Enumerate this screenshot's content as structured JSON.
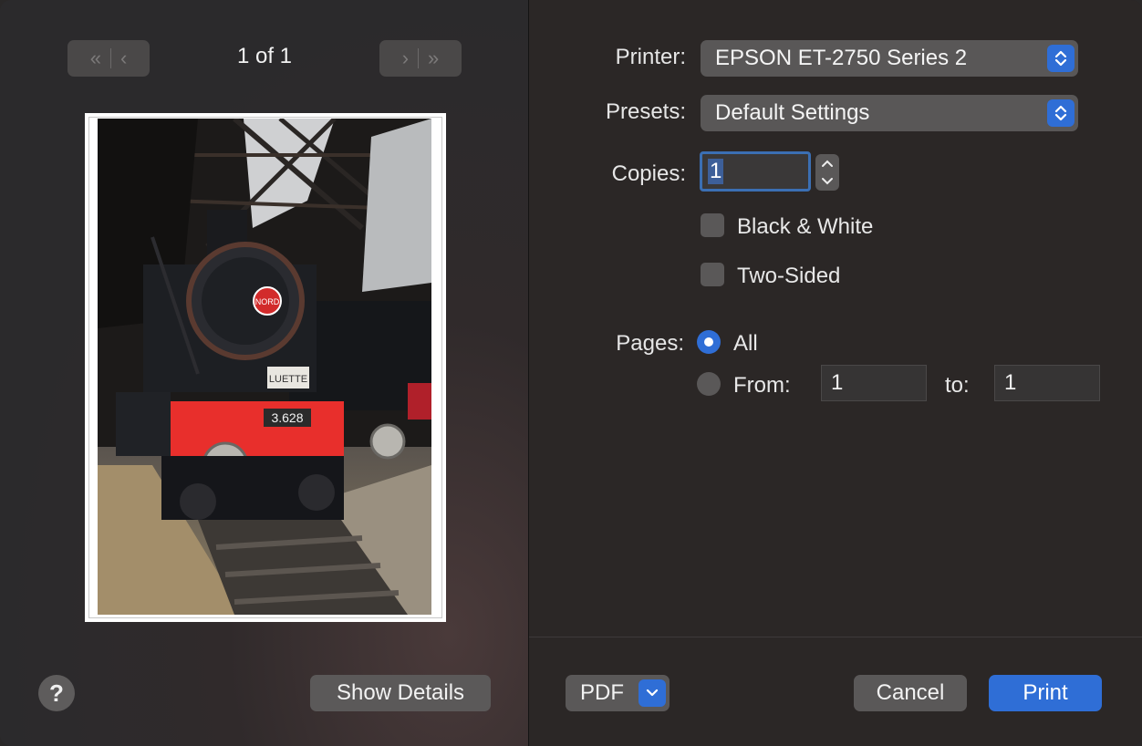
{
  "preview": {
    "page_count": "1 of 1",
    "help_label": "?",
    "show_details_label": "Show Details",
    "plate_text": "3.628",
    "badge_text": "NORD",
    "sign_text": "LUETTE"
  },
  "settings": {
    "printer_label": "Printer:",
    "printer_value": "EPSON ET-2750 Series 2",
    "presets_label": "Presets:",
    "presets_value": "Default Settings",
    "copies_label": "Copies:",
    "copies_value": "1",
    "black_white_label": "Black & White",
    "two_sided_label": "Two-Sided",
    "pages_label": "Pages:",
    "pages_all_label": "All",
    "pages_from_label": "From:",
    "pages_from_value": "1",
    "pages_to_label": "to:",
    "pages_to_value": "1"
  },
  "footer": {
    "pdf_label": "PDF",
    "cancel_label": "Cancel",
    "print_label": "Print"
  },
  "colors": {
    "accent": "#2f6ed6",
    "panel": "#2b2726",
    "button": "#5a5858"
  }
}
